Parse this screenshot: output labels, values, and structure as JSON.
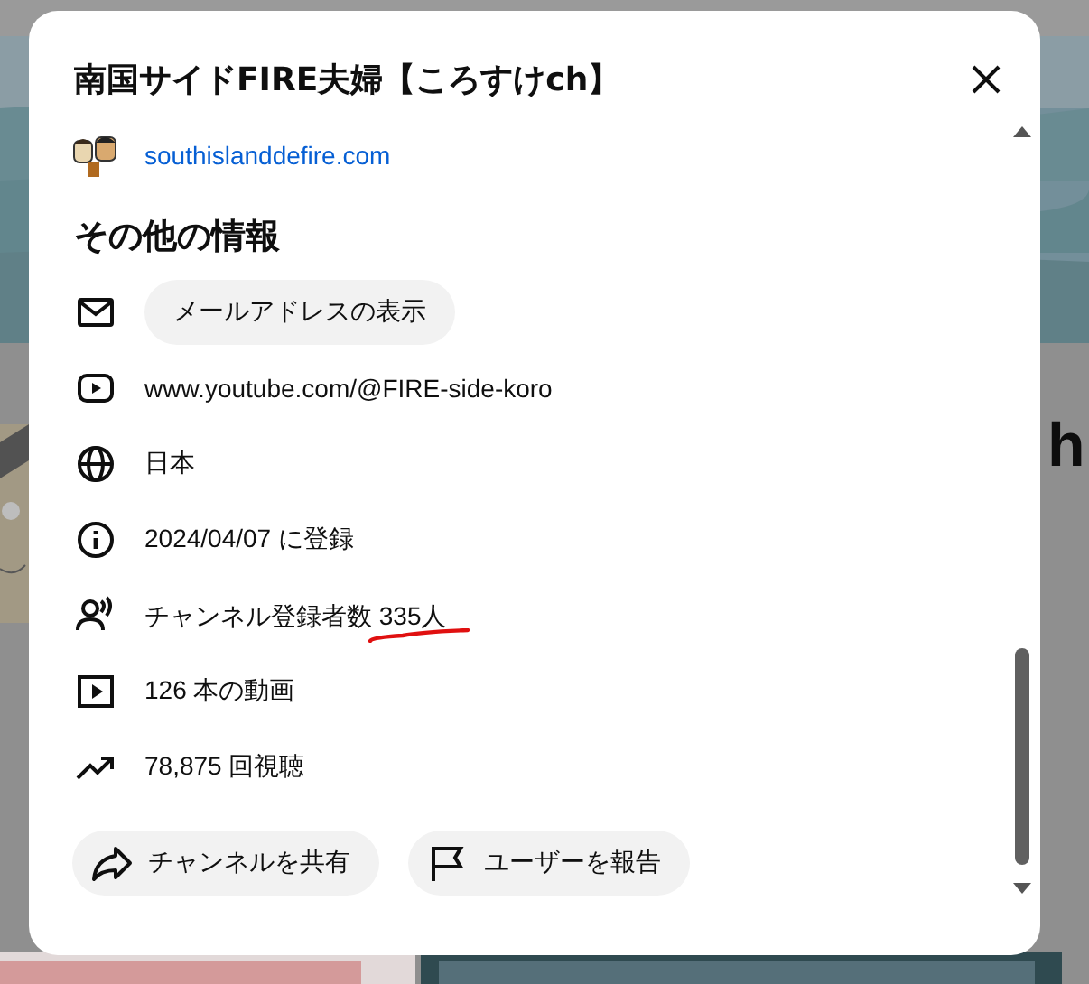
{
  "backdrop": {
    "heading_fragment": "h"
  },
  "dialog": {
    "title": "南国サイドFIRE夫婦【ころすけch】",
    "link": {
      "url": "southislanddefire.com"
    },
    "section_title": "その他の情報",
    "details": [
      {
        "kind": "email",
        "button": "メールアドレスの表示"
      },
      {
        "kind": "url",
        "text": "www.youtube.com/@FIRE-side-koro"
      },
      {
        "kind": "country",
        "text": "日本"
      },
      {
        "kind": "joined",
        "text": "2024/04/07 に登録"
      },
      {
        "kind": "subscribers",
        "text": "チャンネル登録者数 335人"
      },
      {
        "kind": "videos",
        "text": "126 本の動画"
      },
      {
        "kind": "views",
        "text": "78,875 回視聴"
      }
    ],
    "actions": [
      {
        "kind": "share",
        "label": "チャンネルを共有"
      },
      {
        "kind": "report",
        "label": "ユーザーを報告"
      }
    ]
  }
}
